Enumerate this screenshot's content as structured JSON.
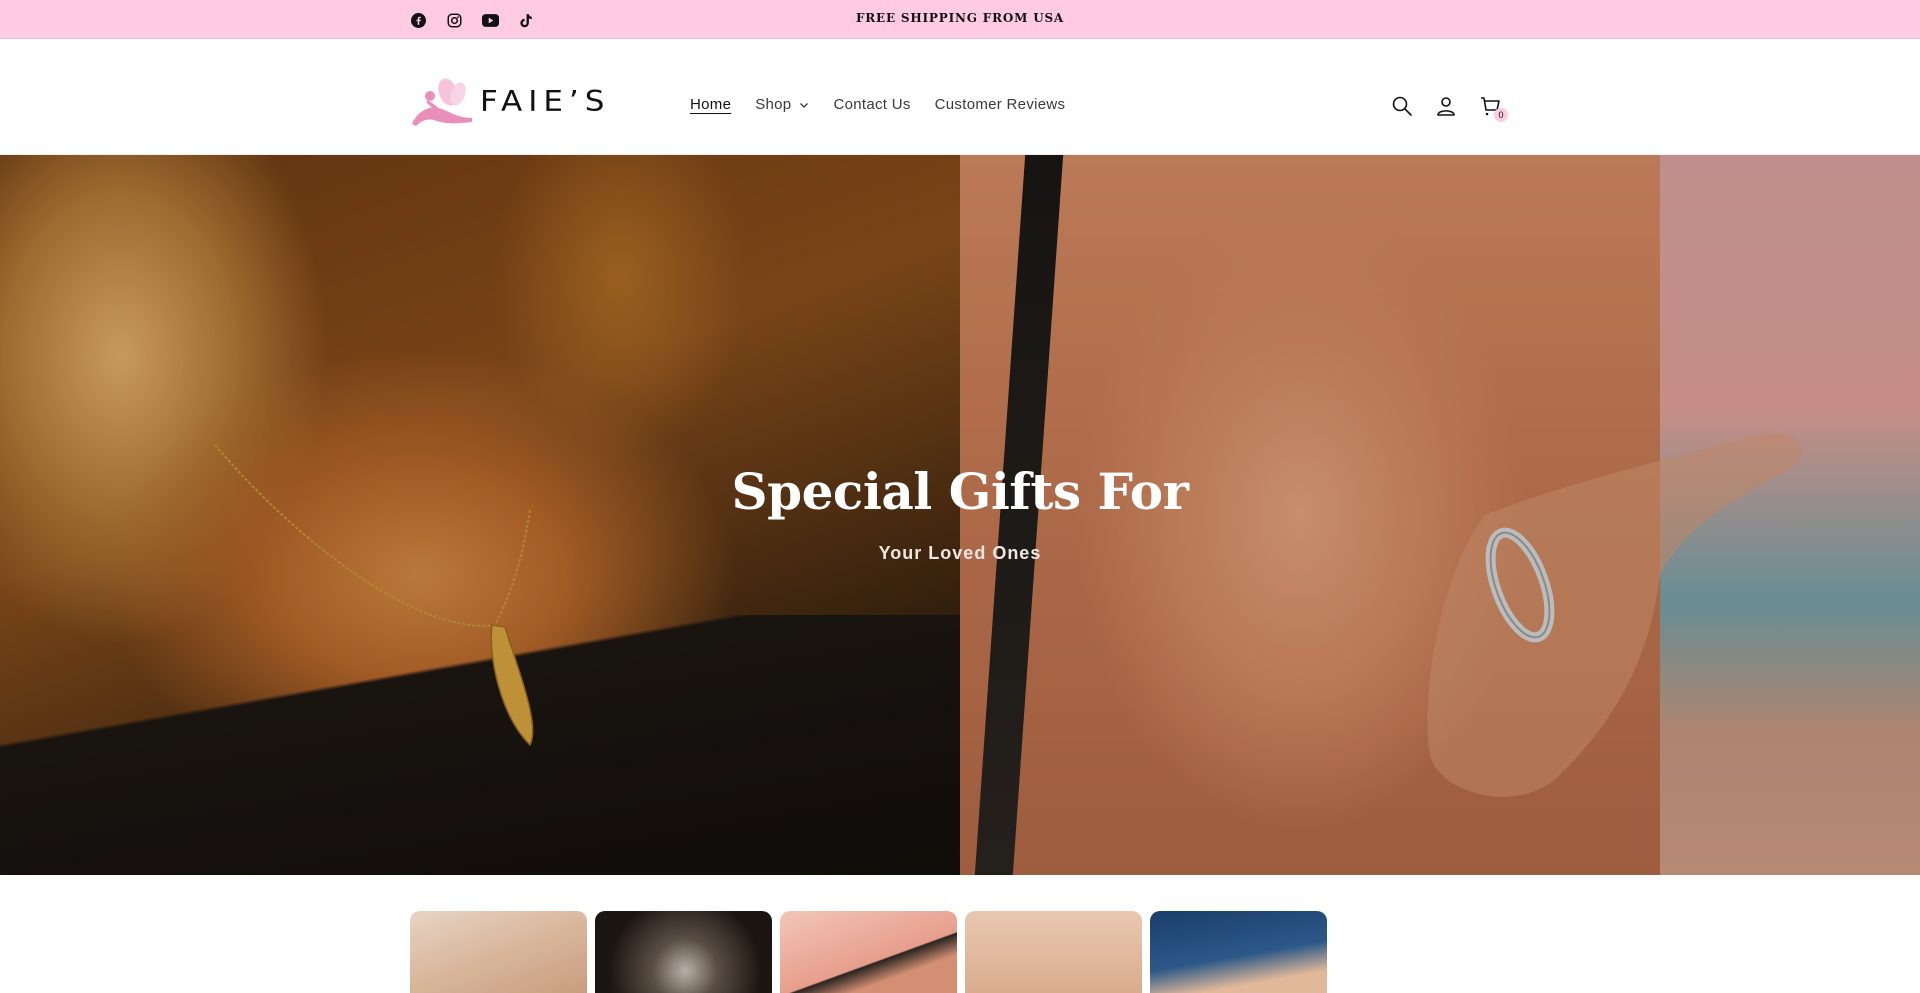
{
  "announcement": {
    "text": "FREE SHIPPING FROM USA",
    "social_icons": [
      "facebook-icon",
      "instagram-icon",
      "youtube-icon",
      "tiktok-icon"
    ]
  },
  "header": {
    "logo_text": "FAIE’S",
    "nav": [
      {
        "label": "Home",
        "active": true
      },
      {
        "label": "Shop",
        "has_dropdown": true
      },
      {
        "label": "Contact Us"
      },
      {
        "label": "Customer Reviews"
      }
    ],
    "icons": [
      "search-icon",
      "account-icon",
      "cart-icon"
    ],
    "cart_count": "0"
  },
  "hero": {
    "title": "Special Gifts For",
    "subtitle": "Your Loved Ones"
  },
  "collections": {
    "thumbnails": [
      "collection-1",
      "collection-2",
      "collection-3",
      "collection-4",
      "collection-5"
    ]
  },
  "colors": {
    "announcement_bg": "#fecbe3",
    "brand_pink": "#f2a7c8"
  }
}
